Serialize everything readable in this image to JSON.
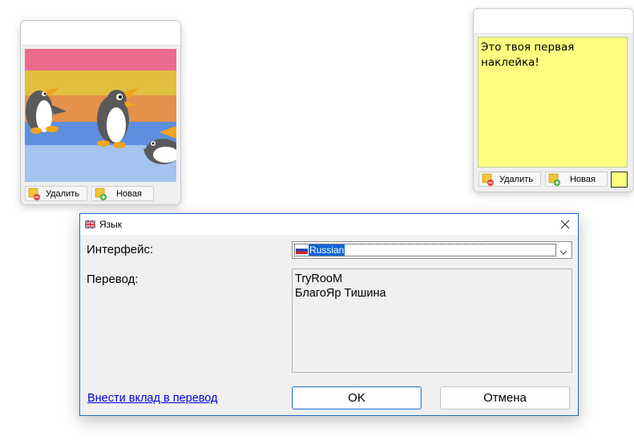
{
  "sticker_photo": {
    "delete_label": "Удалить",
    "new_label": "Новая"
  },
  "sticker_note": {
    "text": "Это твоя первая\nнаклейка!",
    "delete_label": "Удалить",
    "new_label": "Новая",
    "color": "#fffd80"
  },
  "dialog": {
    "title": "Язык",
    "interface_label": "Интерфейс:",
    "interface_value": "Russian",
    "translation_label": "Перевод:",
    "translators": [
      "TryRooM",
      "БлагоЯр Тишина"
    ],
    "contribute_link": "Внести вклад в перевод",
    "ok_label": "OK",
    "cancel_label": "Отмена",
    "accent_color": "#0a64d8"
  }
}
